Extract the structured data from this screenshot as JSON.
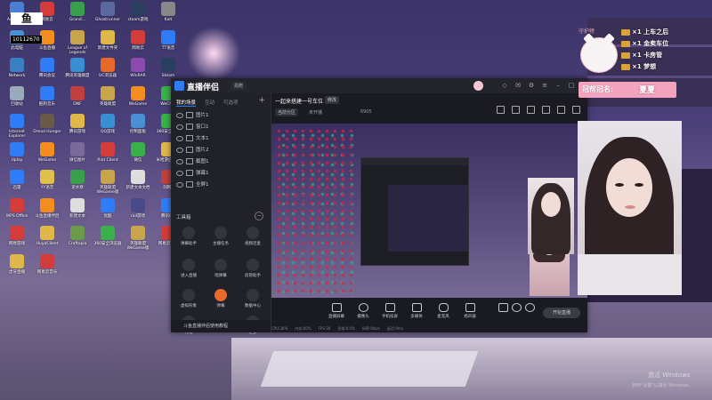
{
  "stream_id_badge": "鱼",
  "room_id": "10112670",
  "desktop_icons": [
    {
      "label": "Adminis...",
      "color": "#4a7fd4"
    },
    {
      "label": "网易云",
      "color": "#d43b3b"
    },
    {
      "label": "Grand...",
      "color": "#3a9f4a"
    },
    {
      "label": "Ghostrunner",
      "color": "#5a6aa0"
    },
    {
      "label": "steam游戏",
      "color": "#2a3f5f"
    },
    {
      "label": "Kalt",
      "color": "#888888"
    },
    {
      "label": "此电脑",
      "color": "#4a8fd4"
    },
    {
      "label": "斗鱼直播",
      "color": "#f28d1e"
    },
    {
      "label": "League of Legends",
      "color": "#c8a44a"
    },
    {
      "label": "新建文件夹",
      "color": "#e0b84a"
    },
    {
      "label": "网易云",
      "color": "#d43b3b"
    },
    {
      "label": "TT语音",
      "color": "#2f7df6"
    },
    {
      "label": "Network",
      "color": "#3a7fc4"
    },
    {
      "label": "腾讯会议",
      "color": "#2f7df6"
    },
    {
      "label": "腾讯英雄联盟",
      "color": "#3a8fd4"
    },
    {
      "label": "UC浏览器",
      "color": "#e86a2a"
    },
    {
      "label": "WinRAR",
      "color": "#8a4ab0"
    },
    {
      "label": "Steam",
      "color": "#2a3f5f"
    },
    {
      "label": "回收站",
      "color": "#9ab"
    },
    {
      "label": "酷狗音乐",
      "color": "#2f7df6"
    },
    {
      "label": "DNF",
      "color": "#c04040"
    },
    {
      "label": "英雄联盟",
      "color": "#c8a44a"
    },
    {
      "label": "WeGame",
      "color": "#f28d1e"
    },
    {
      "label": "WeChat",
      "color": "#3ab04a"
    },
    {
      "label": "Internet Explorer",
      "color": "#2f7df6"
    },
    {
      "label": "Dread Hunger",
      "color": "#6a5a4a"
    },
    {
      "label": "腾讯游戏",
      "color": "#e0b84a"
    },
    {
      "label": "QQ游戏",
      "color": "#3a8fd4"
    },
    {
      "label": "控制面板",
      "color": "#4a8fd4"
    },
    {
      "label": "360安全管家",
      "color": "#3ab04a"
    },
    {
      "label": "Uplay",
      "color": "#2f7df6"
    },
    {
      "label": "WeGame",
      "color": "#f28d1e"
    },
    {
      "label": "微信图片",
      "color": "#7a6a9a"
    },
    {
      "label": "Riot Client",
      "color": "#d43b3b"
    },
    {
      "label": "微信",
      "color": "#3ab04a"
    },
    {
      "label": "米哈游启动器",
      "color": "#e0b84a"
    },
    {
      "label": "迅雷",
      "color": "#2f7df6"
    },
    {
      "label": "YY语音",
      "color": "#e0c04a"
    },
    {
      "label": "逆水寒",
      "color": "#3a9f4a"
    },
    {
      "label": "英雄联盟WeGame版",
      "color": "#c8a44a"
    },
    {
      "label": "新建文本文档",
      "color": "#dddddd"
    },
    {
      "label": "剑网3",
      "color": "#c04040"
    },
    {
      "label": "WPS Office",
      "color": "#d43b3b"
    },
    {
      "label": "斗鱼直播伴侣",
      "color": "#f28d1e"
    },
    {
      "label": "新建文本",
      "color": "#dddddd"
    },
    {
      "label": "优酷",
      "color": "#2f7df6"
    },
    {
      "label": "rail游戏",
      "color": "#4a4a8a"
    },
    {
      "label": "腾讯QQ",
      "color": "#2f7df6"
    },
    {
      "label": "网易游戏",
      "color": "#d43b3b"
    },
    {
      "label": "HuyaClient",
      "color": "#e0b84a"
    },
    {
      "label": "Craftopia",
      "color": "#6a9a4a"
    },
    {
      "label": "360安全浏览器",
      "color": "#3ab04a"
    },
    {
      "label": "英雄联盟WeGame版",
      "color": "#c8a44a"
    },
    {
      "label": "网易云音乐",
      "color": "#d43b3b"
    },
    {
      "label": "虎牙直播",
      "color": "#e0b84a"
    },
    {
      "label": "网易云音乐",
      "color": "#d43b3b"
    }
  ],
  "app": {
    "title": "直播伴侣",
    "badge": "捐赠",
    "sidebar_tabs": [
      "我的场景",
      "互动",
      "可选项"
    ],
    "scenes": [
      "图片1",
      "窗口1",
      "文本1",
      "图片2",
      "截图1",
      "弹幕1",
      "全屏1"
    ],
    "tools_header": "工具箱",
    "tools": [
      "弹幕助手",
      "主播任务",
      "视频连麦",
      "进入直播",
      "唱弹幕",
      "房管助手",
      "虚拟形象",
      "弹幕",
      "数据中心",
      "礼物",
      "更多"
    ],
    "sidebar_bottom": "斗鱼直播伴侣使用教程",
    "room_title": "一起来搭建一号车位",
    "room_edit": "修改",
    "room_category": "当前分区",
    "room_status": "未开播",
    "room_num": "6905",
    "controls": [
      "直播屏幕",
      "摄像头",
      "手机投屏",
      "多媒体",
      "麦克风",
      "扬声器"
    ],
    "start_label": "开始直播",
    "status": [
      "CPU:38%",
      "内存:60%",
      "FPS:30",
      "丢帧:0.0%",
      "码率:0kb/s",
      "延迟:0ms"
    ]
  },
  "overlay": {
    "pig_label": "守护榜",
    "gifts": [
      "×1 上车之后",
      "×1 金卖车位",
      "×1 卡房管",
      "×1 梦想"
    ],
    "guard_label": "冠帮冠名:",
    "guard_name": "夏夏"
  },
  "watermark": {
    "line1": "激活 Windows",
    "line2": "转到\"设置\"以激活 Windows。"
  }
}
